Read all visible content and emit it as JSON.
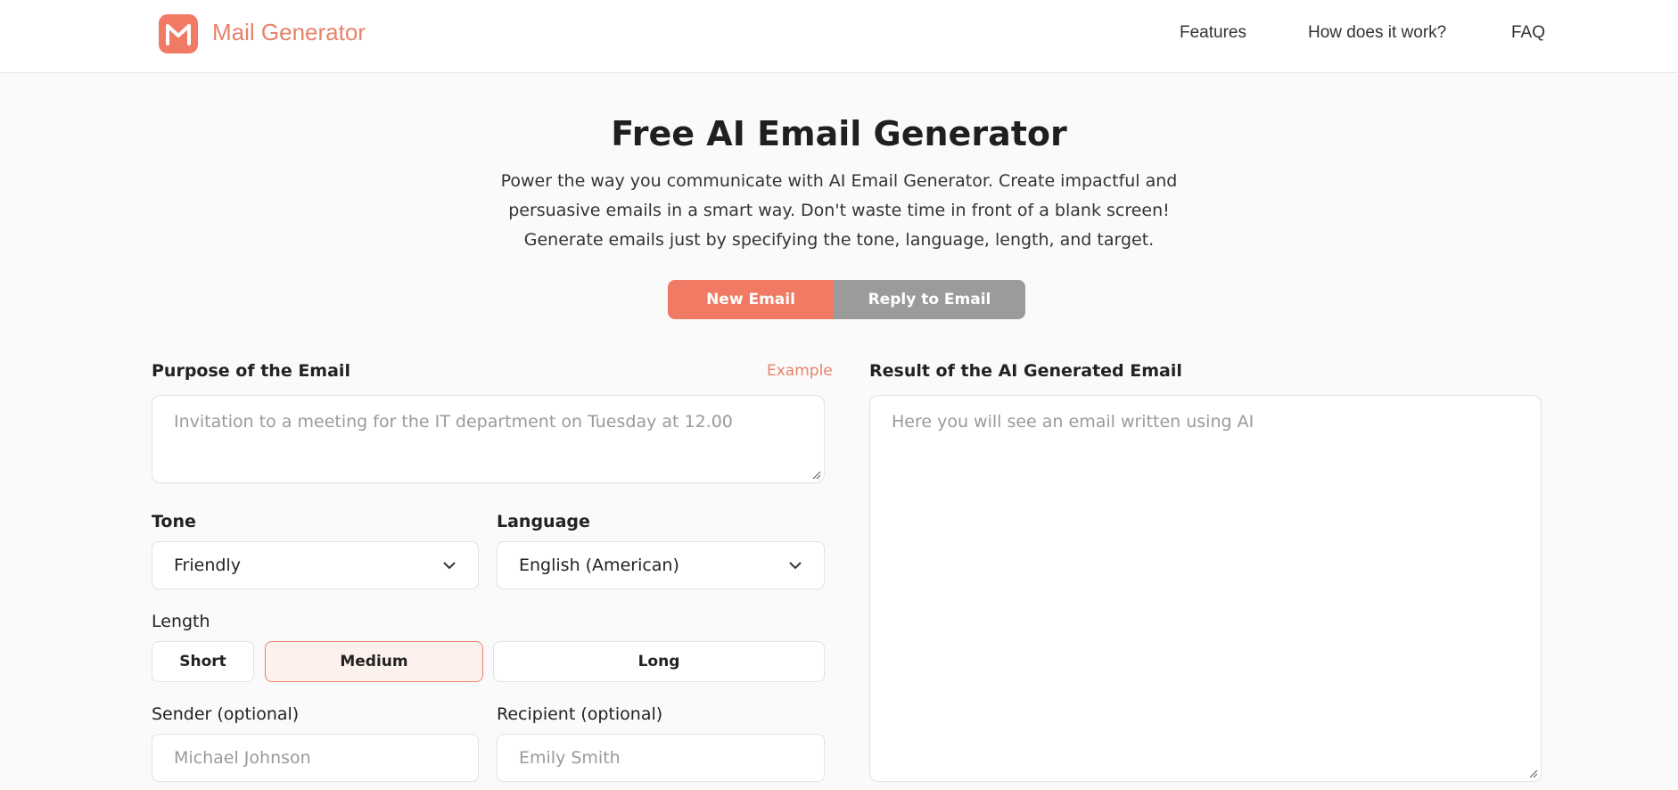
{
  "header": {
    "brand": "Mail Generator",
    "nav": [
      "Features",
      "How does it work?",
      "FAQ"
    ]
  },
  "hero": {
    "title": "Free AI Email Generator",
    "description": "Power the way you communicate with AI Email Generator. Create impactful and persuasive emails in a smart way. Don't waste time in front of a blank screen! Generate emails just by specifying the tone, language, length, and target."
  },
  "mode_toggle": {
    "new_email": "New Email",
    "reply_email": "Reply to Email",
    "selected": "New Email"
  },
  "form": {
    "purpose_label": "Purpose of the Email",
    "example_link": "Example",
    "purpose_placeholder": "Invitation to a meeting for the IT department on Tuesday at 12.00",
    "tone_label": "Tone",
    "tone_value": "Friendly",
    "language_label": "Language",
    "language_value": "English (American)",
    "length_label": "Length",
    "length_options": [
      "Short",
      "Medium",
      "Long"
    ],
    "length_selected": "Medium",
    "sender_label": "Sender (optional)",
    "sender_placeholder": "Michael Johnson",
    "recipient_label": "Recipient (optional)",
    "recipient_placeholder": "Emily Smith"
  },
  "result": {
    "label": "Result of the AI Generated Email",
    "placeholder": "Here you will see an email written using AI"
  },
  "colors": {
    "accent": "#f07a63",
    "inactive_toggle": "#9b9b9b",
    "selected_length_bg": "#fdf1ee"
  }
}
